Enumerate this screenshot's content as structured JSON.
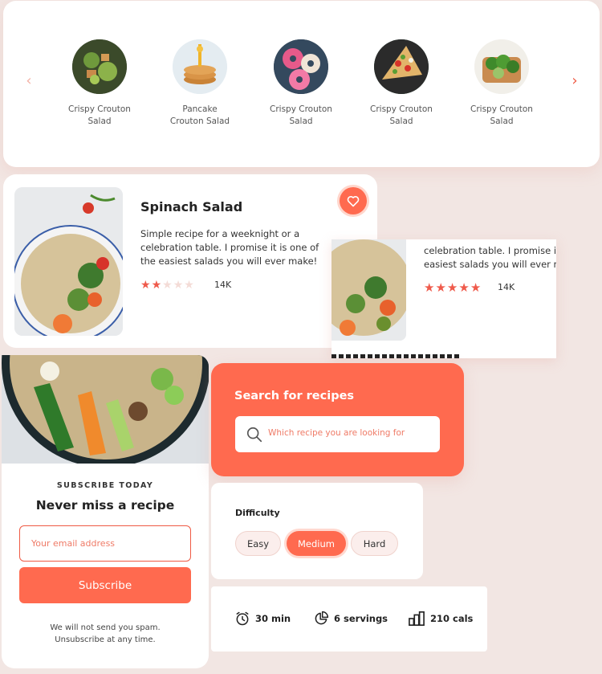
{
  "carousel": {
    "items": [
      {
        "label_line1": "Crispy Crouton",
        "label_line2": "Salad"
      },
      {
        "label_line1": "Pancake",
        "label_line2": "Crouton Salad"
      },
      {
        "label_line1": "Crispy Crouton",
        "label_line2": "Salad"
      },
      {
        "label_line1": "Crispy Crouton",
        "label_line2": "Salad"
      },
      {
        "label_line1": "Crispy Crouton",
        "label_line2": "Salad"
      }
    ],
    "prev_glyph": "‹",
    "next_glyph": "›"
  },
  "recipe_card": {
    "title": "Spinach Salad",
    "description": "Simple recipe for a weeknight or a celebration table. I promise it is one of the easiest salads you will ever make!",
    "rating_filled": 2,
    "rating_max": 5,
    "rating_count": "14K",
    "favorite_icon": "heart-icon"
  },
  "recipe_card_partial": {
    "desc_line1": "celebration table. I promise it",
    "desc_line2": "easiest salads you will ever m",
    "rating_filled": 5,
    "rating_max": 5,
    "rating_count": "14K"
  },
  "subscribe": {
    "kicker": "SUBSCRIBE TODAY",
    "title": "Never miss a recipe",
    "email_placeholder": "Your email address",
    "button_label": "Subscribe",
    "note_line1": "We will not send you spam.",
    "note_line2": "Unsubscribe at any time."
  },
  "search": {
    "title": "Search for recipes",
    "placeholder": "Which recipe you are looking for",
    "icon": "search-icon"
  },
  "difficulty": {
    "title": "Difficulty",
    "options": [
      "Easy",
      "Medium",
      "Hard"
    ],
    "selected": "Medium"
  },
  "stats": {
    "time": "30 min",
    "servings": "6 servings",
    "calories": "210 cals"
  },
  "colors": {
    "accent": "#ff6a4f",
    "background": "#f2e6e3",
    "star_empty": "#f4dcd7"
  }
}
